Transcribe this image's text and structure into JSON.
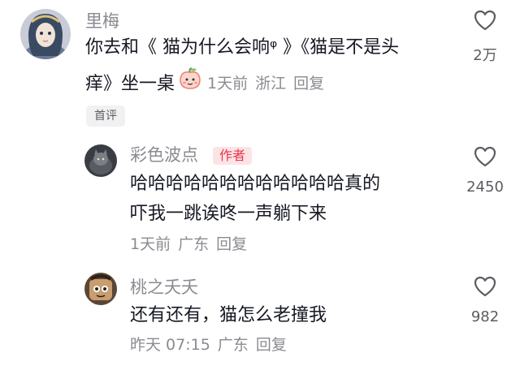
{
  "comments": [
    {
      "username": "里梅",
      "line1_prefix": "你去和",
      "link1": "《 猫为什么会响ᵠ 》",
      "link2": "《猫是不是头",
      "line2_prefix": "痒》坐一桌",
      "meta": {
        "time": "1天前",
        "location": "浙江",
        "reply": "回复"
      },
      "likes": "2万",
      "tag": "首评"
    },
    {
      "username": "彩色波点",
      "badge": "作者",
      "line1": "哈哈哈哈哈哈哈哈哈哈哈哈真的",
      "line2": "吓我一跳诶咚一声躺下来",
      "meta": {
        "time": "1天前",
        "location": "广东",
        "reply": "回复"
      },
      "likes": "2450"
    },
    {
      "username": "桃之夭夭",
      "line1": "还有还有，猫怎么老撞我",
      "meta": {
        "time": "昨天 07:15",
        "location": "广东",
        "reply": "回复"
      },
      "likes": "982"
    }
  ],
  "icons": {
    "like": "heart-outline-icon",
    "sticker": "peach-sticker-icon"
  },
  "colors": {
    "author_badge_bg": "#fce4e6",
    "author_badge_text": "#e8364b",
    "muted": "#8a8b91",
    "text": "#161823"
  }
}
